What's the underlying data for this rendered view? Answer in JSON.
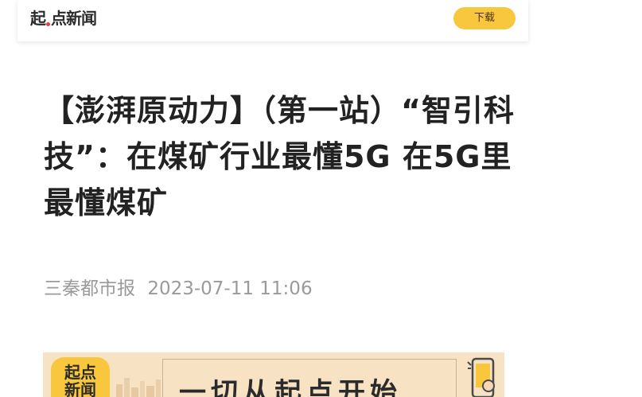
{
  "header": {
    "logo_text_1": "起",
    "logo_text_2": "点新闻",
    "download_label": "下载"
  },
  "article": {
    "title": "【澎湃原动力】（第一站）“智引科技”：在煤矿行业最懂5G 在5G里最懂煤矿",
    "source": "三秦都市报",
    "datetime": "2023-07-11 11:06"
  },
  "banner": {
    "app_icon_text_1": "起点",
    "app_icon_text_2": "新闻",
    "slogan": "一切从起点开始"
  },
  "colors": {
    "accent": "#f9c73e",
    "logo_dot": "#e7403a",
    "banner_bg": "#f7e2c3",
    "title_text": "#222222",
    "meta_text": "#9a9a9a"
  },
  "icons": [
    "logo",
    "phone-illustration-icon",
    "city-skyline-icon"
  ]
}
